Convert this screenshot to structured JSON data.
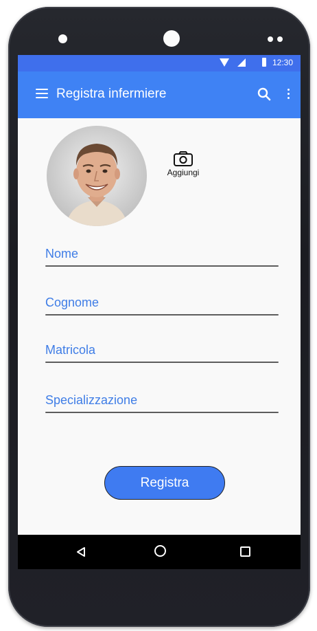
{
  "status_bar": {
    "time": "12:30",
    "icons": [
      "wifi-icon",
      "signal-icon",
      "battery-icon"
    ]
  },
  "app_bar": {
    "title": "Registra infermiere",
    "icons": [
      "menu-icon",
      "search-icon",
      "more-vert-icon"
    ]
  },
  "profile": {
    "add_photo_label": "Aggiungi",
    "icon": "camera-icon"
  },
  "form": {
    "fields": [
      {
        "label": "Nome",
        "value": ""
      },
      {
        "label": "Cognome",
        "value": ""
      },
      {
        "label": "Matricola",
        "value": ""
      },
      {
        "label": "Specializzazione",
        "value": ""
      }
    ],
    "submit_label": "Registra"
  },
  "nav_bar": {
    "icons": [
      "back-icon",
      "home-icon",
      "recents-icon"
    ]
  },
  "colors": {
    "status_bar": "#3f6fec",
    "app_bar": "#3f82f4",
    "field_label": "#3f7de6",
    "button": "#3f7bf1",
    "screen_bg": "#f9f9f9"
  }
}
